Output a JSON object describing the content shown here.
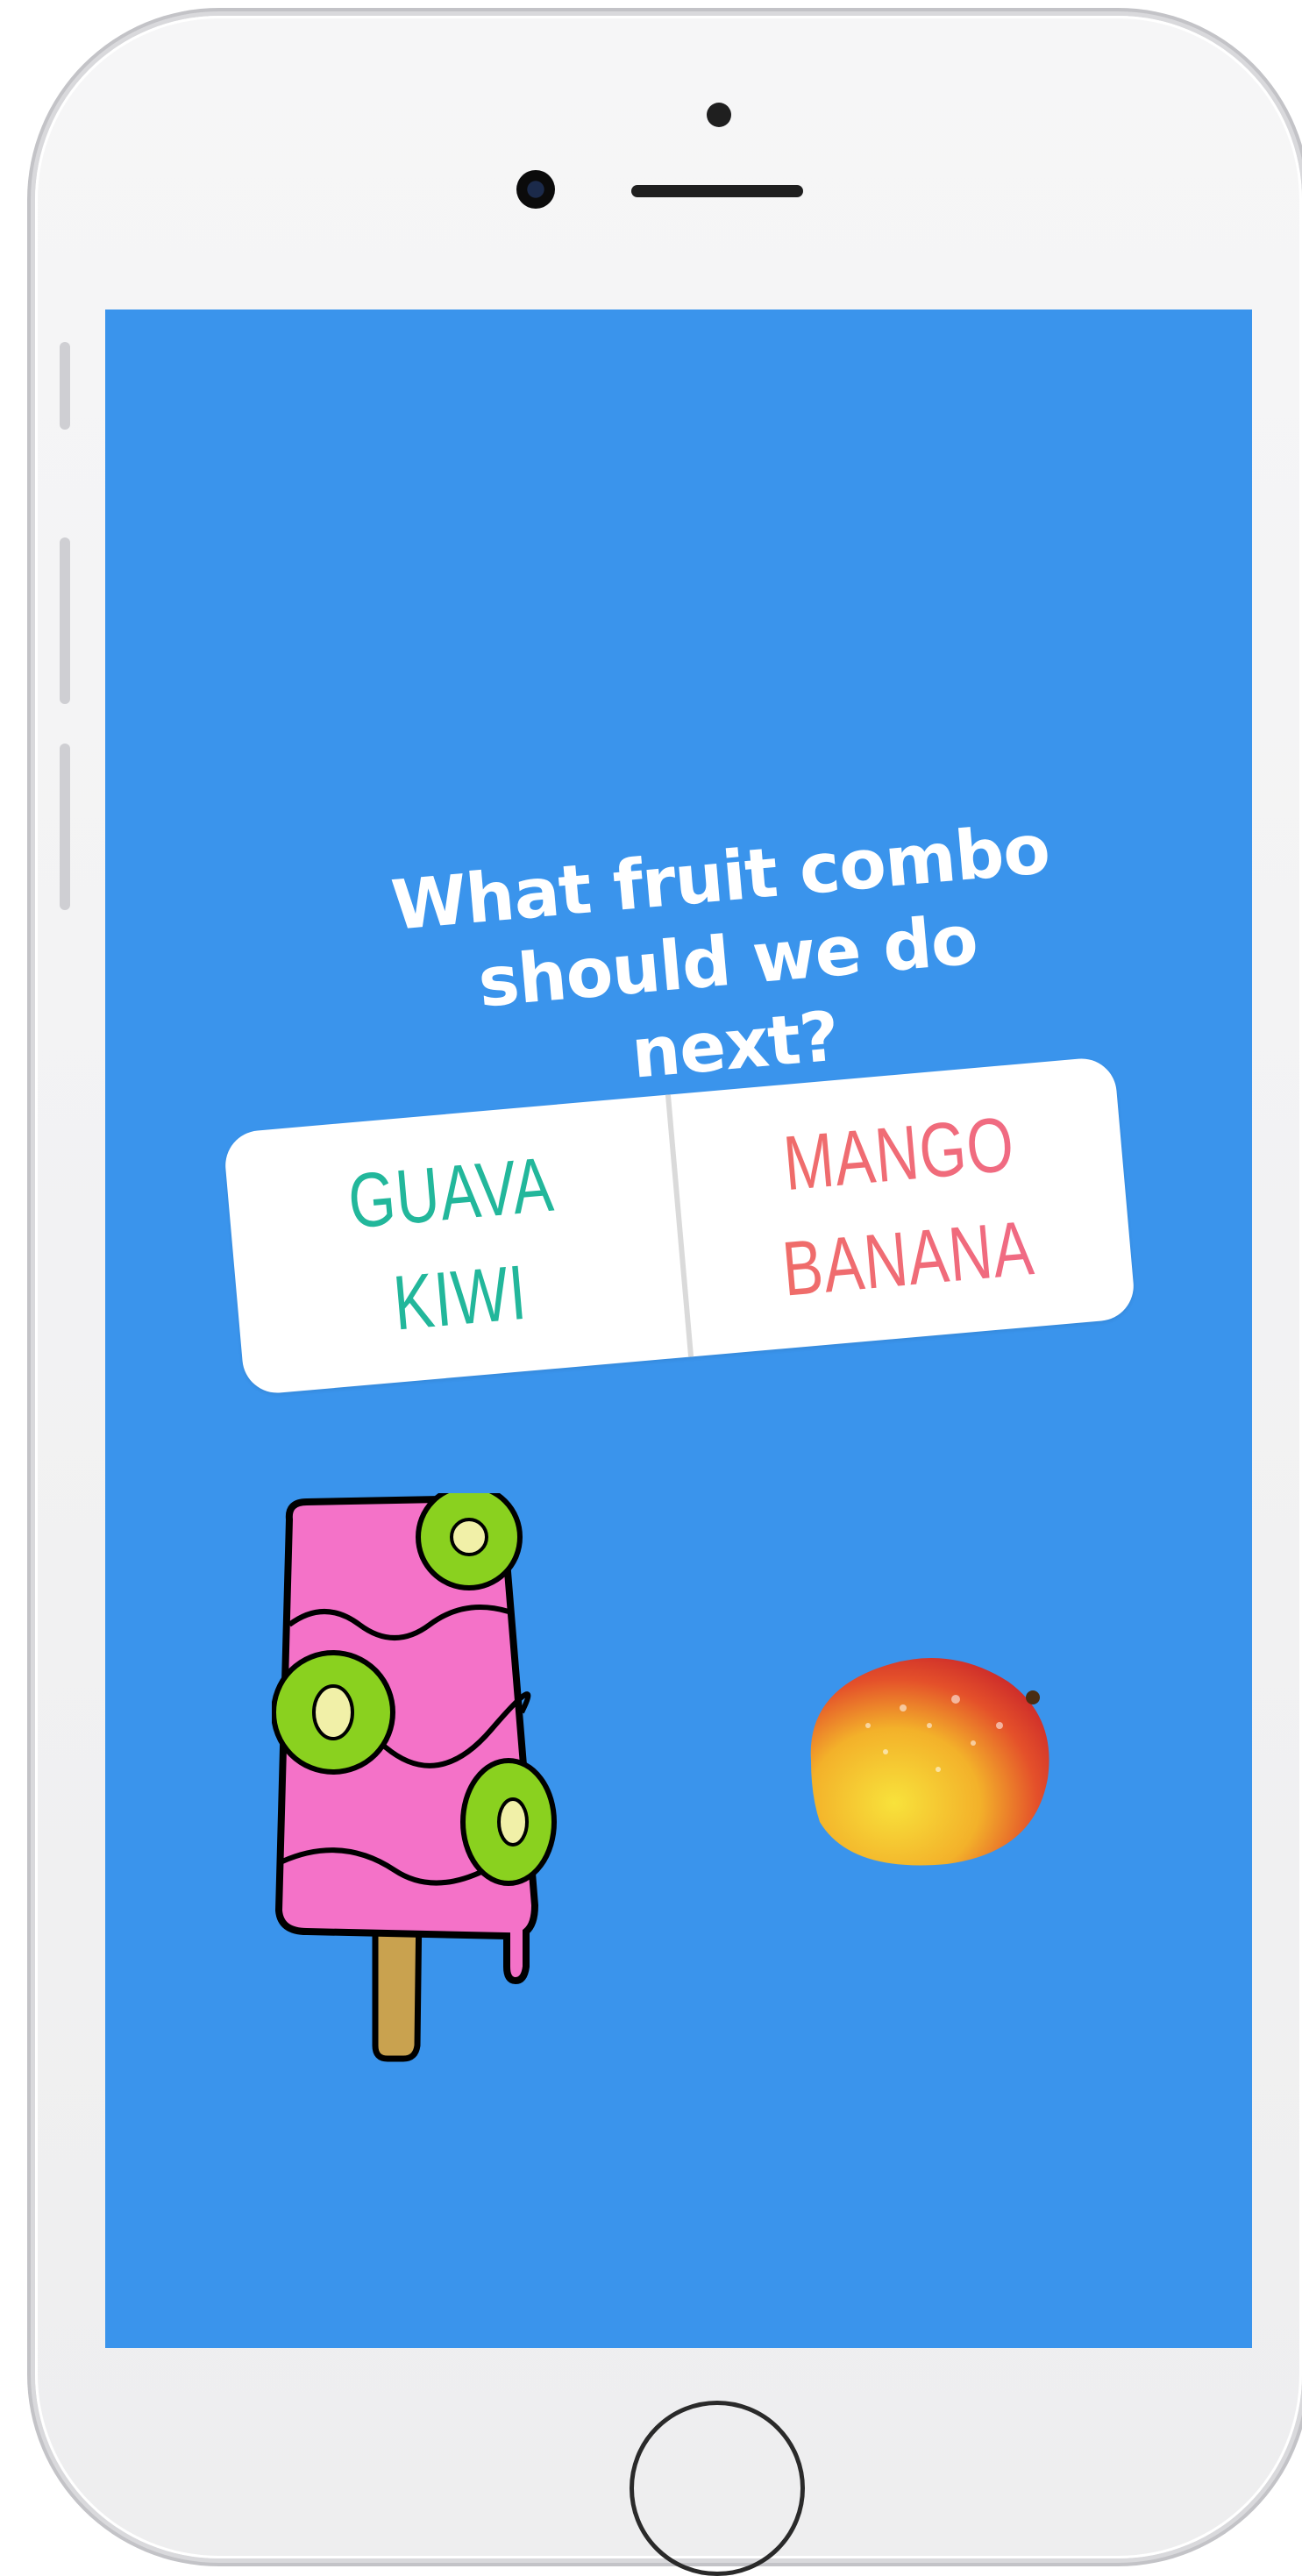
{
  "story": {
    "question_line1": "What fruit combo",
    "question_line2": "should we do next?"
  },
  "poll": {
    "left_option": {
      "line1": "GUAVA",
      "line2": "KIWI",
      "color": "#22b79b"
    },
    "right_option": {
      "line1": "MANGO",
      "line2": "BANANA",
      "color": "#ef6d63"
    }
  },
  "stickers": {
    "popsicle": "kiwi-popsicle-sticker",
    "mango": "mango-sticker"
  },
  "colors": {
    "background": "#3a94ec",
    "text": "#ffffff"
  }
}
